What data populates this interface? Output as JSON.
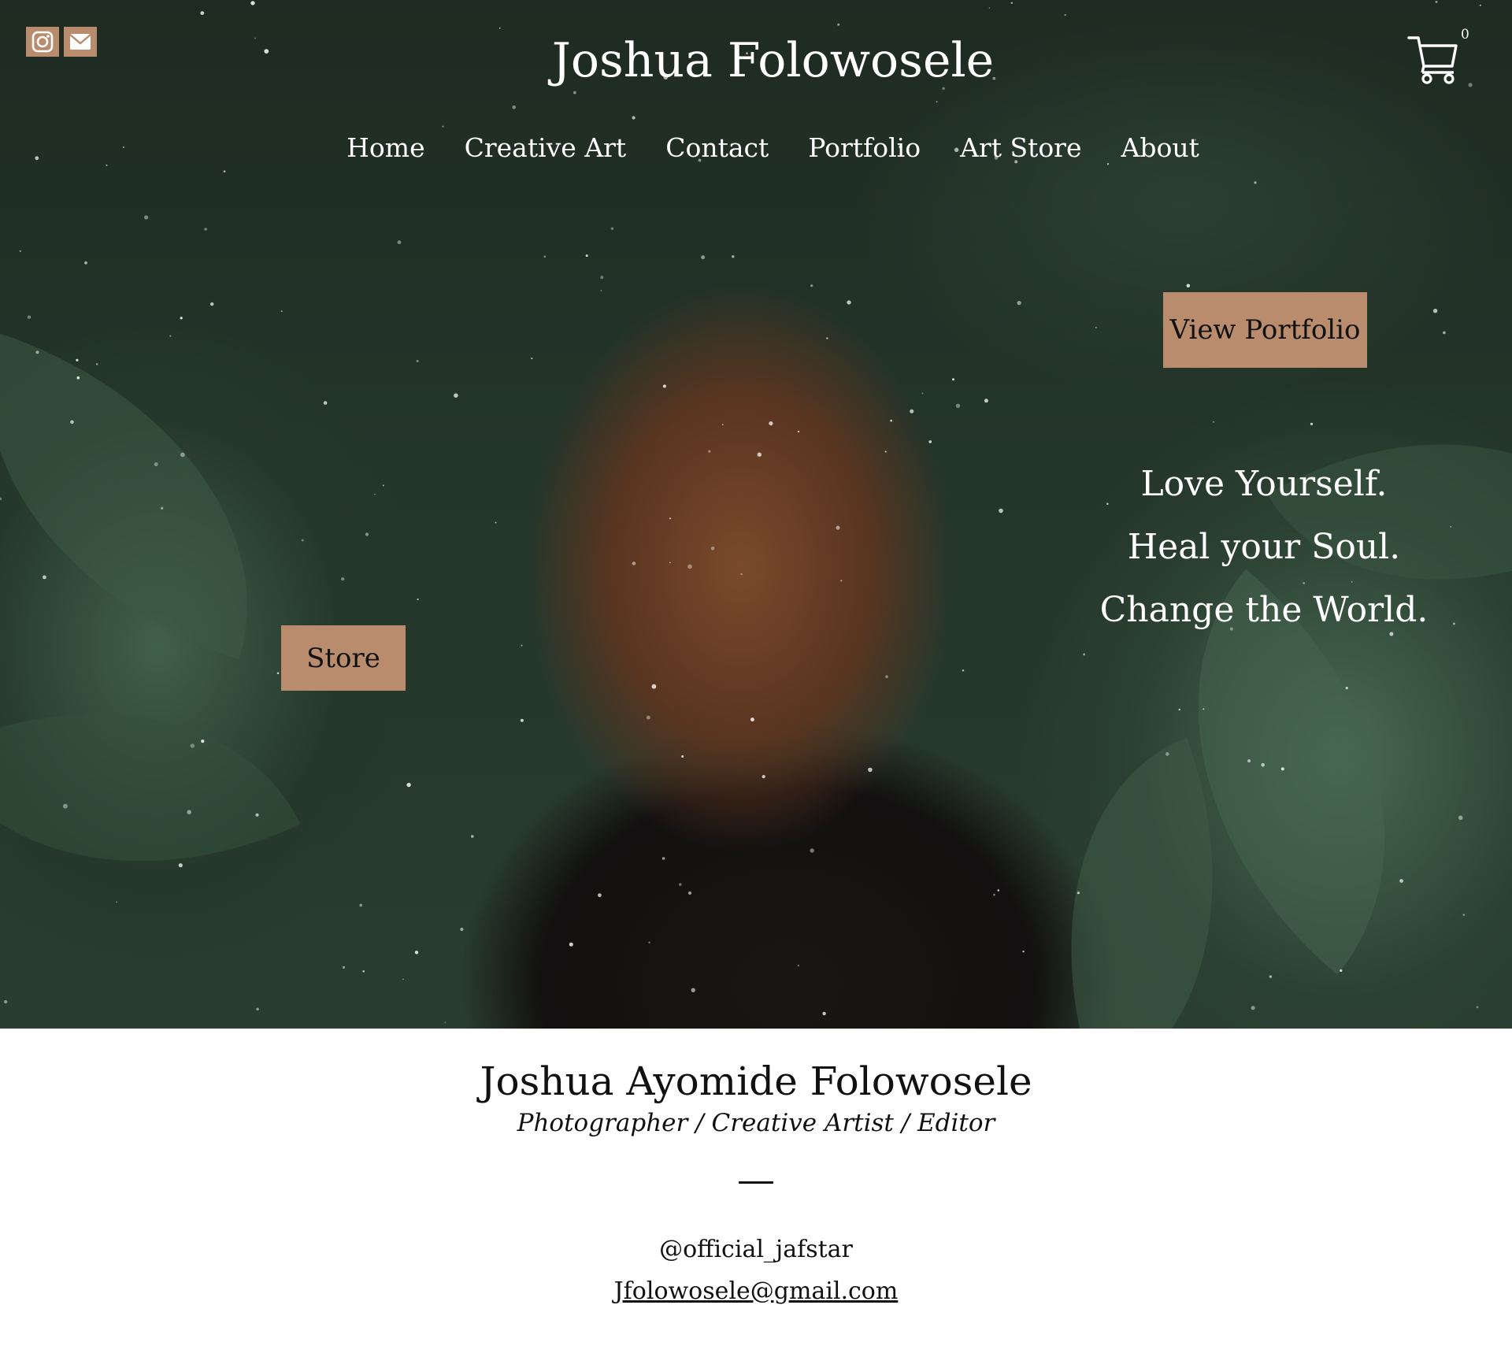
{
  "colors": {
    "accent": "#b88c6c",
    "hero_text": "#ffffff",
    "body_text": "#111111"
  },
  "header": {
    "title": "Joshua Folowosele",
    "social": [
      {
        "icon": "instagram-icon"
      },
      {
        "icon": "mail-icon"
      }
    ],
    "cart_count": "0"
  },
  "nav": {
    "items": [
      {
        "label": "Home"
      },
      {
        "label": "Creative Art"
      },
      {
        "label": "Contact"
      },
      {
        "label": "Portfolio"
      },
      {
        "label": "Art Store"
      },
      {
        "label": "About"
      }
    ]
  },
  "hero": {
    "portfolio_button": "View Portfolio",
    "store_button": "Store",
    "tagline": [
      "Love Yourself.",
      "Heal your Soul.",
      "Change the World."
    ]
  },
  "profile": {
    "name": "Joshua Ayomide Folowosele",
    "role": "Photographer / Creative Artist / Editor",
    "handle": "@official_jafstar",
    "email": "Jfolowosele@gmail.com"
  }
}
